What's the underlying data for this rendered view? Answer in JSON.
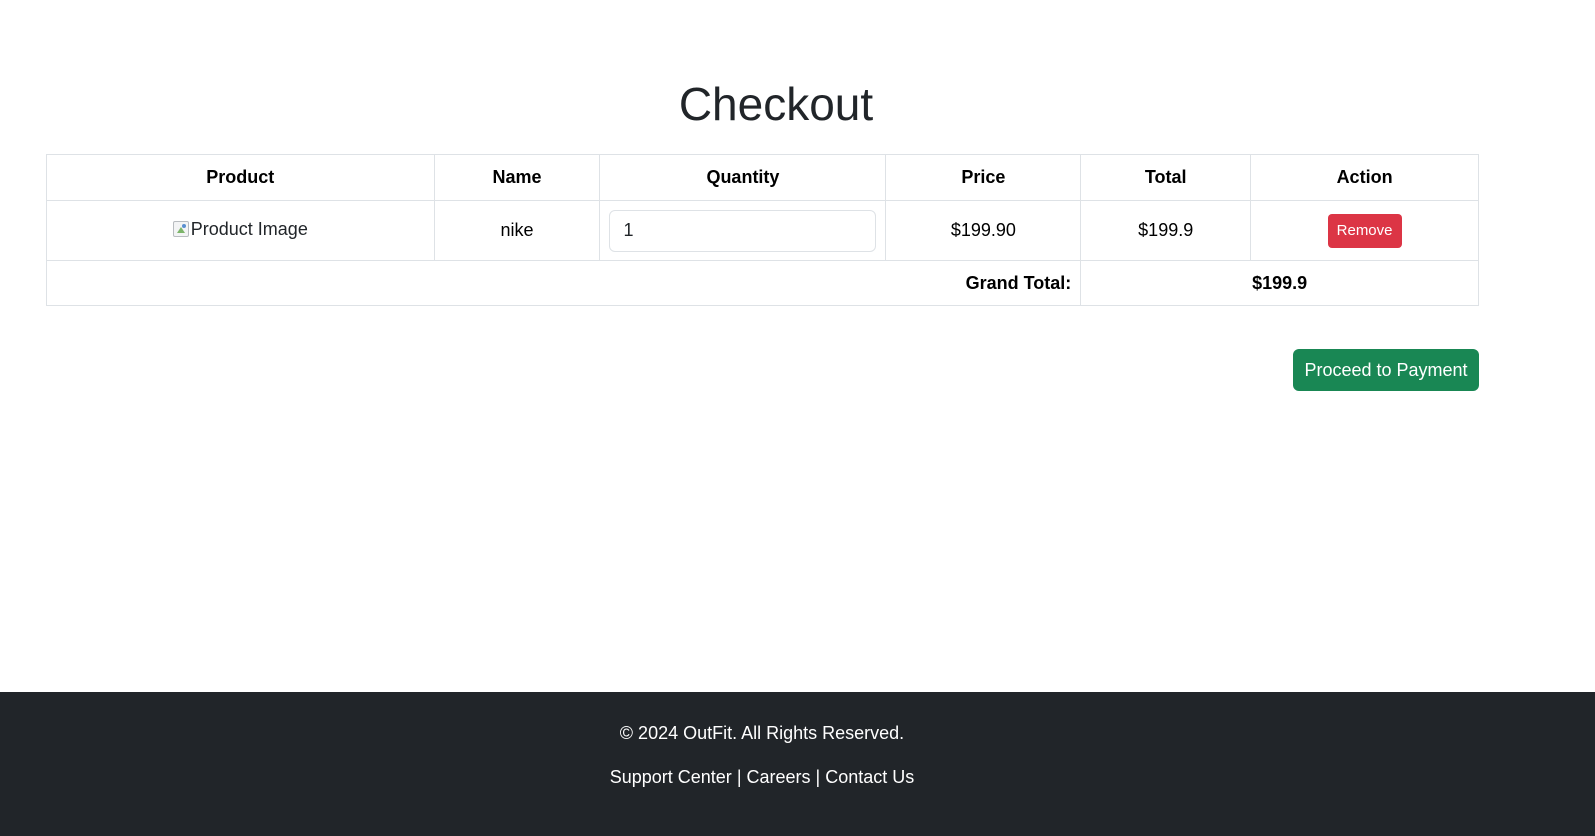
{
  "page": {
    "title": "Checkout"
  },
  "cart_table": {
    "headers": [
      "Product",
      "Name",
      "Quantity",
      "Price",
      "Total",
      "Action"
    ],
    "rows": [
      {
        "image_alt": "Product Image",
        "name": "nike",
        "quantity": "1",
        "price": "$199.90",
        "total": "$199.9",
        "action_label": "Remove"
      }
    ],
    "grand_total_label": "Grand Total:",
    "grand_total_value": "$199.9"
  },
  "actions": {
    "proceed_label": "Proceed to Payment"
  },
  "footer": {
    "copyright": "© 2024 OutFit. All Rights Reserved.",
    "links": [
      "Support Center",
      "Careers",
      "Contact Us"
    ],
    "separator": "|"
  },
  "colors": {
    "remove_button": "#dc3545",
    "proceed_button": "#198754",
    "footer_background": "#212529"
  },
  "icons": {
    "broken_image": "broken-image-icon"
  }
}
